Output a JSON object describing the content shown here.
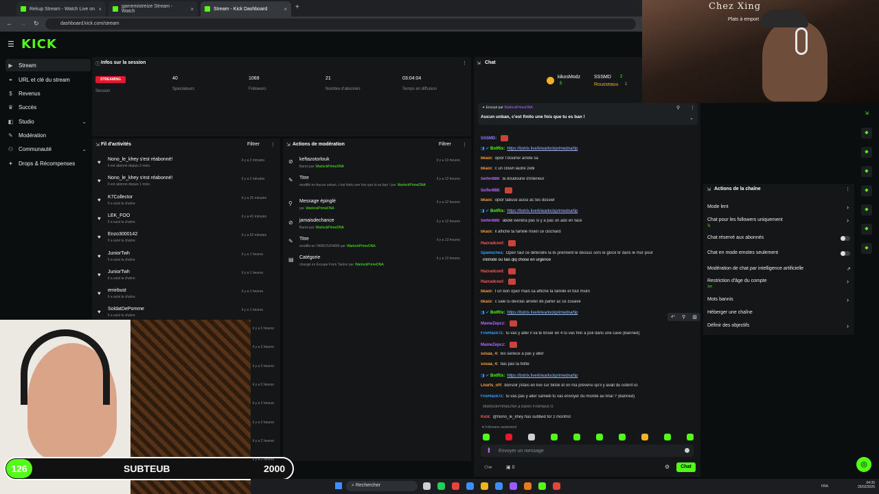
{
  "browser": {
    "tabs": [
      {
        "title": "Rekup Stream - Watch Live on",
        "close": "×"
      },
      {
        "title": "gamemistreize Stream - Watch",
        "close": "×"
      },
      {
        "title": "Stream - Kick Dashboard",
        "close": "×"
      }
    ],
    "new_tab": "+",
    "url": "dashboard.kick.com/stream"
  },
  "header": {
    "logo": "KICK",
    "menu_icon": "hamburger-icon"
  },
  "sidebar": {
    "items": [
      {
        "label": "Stream",
        "icon": "stream-icon"
      },
      {
        "label": "URL et clé du stream",
        "icon": "link-icon"
      },
      {
        "label": "Revenus",
        "icon": "dollar-icon"
      },
      {
        "label": "Succès",
        "icon": "trophy-icon"
      },
      {
        "label": "Studio",
        "icon": "studio-icon"
      },
      {
        "label": "Modération",
        "icon": "wrench-icon"
      },
      {
        "label": "Communauté",
        "icon": "people-icon"
      },
      {
        "label": "Drops & Récompenses",
        "icon": "gift-icon"
      }
    ]
  },
  "session": {
    "title": "Infos sur la session",
    "badge": "STREAMING",
    "stats": [
      {
        "value": "",
        "label": "Session"
      },
      {
        "value": "40",
        "label": "Spectateurs"
      },
      {
        "value": "1069",
        "label": "Followers"
      },
      {
        "value": "21",
        "label": "Nombre d'abonnés"
      },
      {
        "value": "03:04:04",
        "label": "Temps en diffusion"
      }
    ]
  },
  "activity": {
    "title": "Fil d'activités",
    "filter": "Filtrer",
    "items": [
      {
        "name": "Nono_le_khey s'est réabonné!",
        "sub": "Il est abonné depuis 2 mois.",
        "time": "il y a 2 minutes"
      },
      {
        "name": "Nono_le_khey s'est réabonné!",
        "sub": "Il est abonné depuis 1 mois.",
        "time": "il y a 2 minutes"
      },
      {
        "name": "K7Collector",
        "sub": "Il a suivi la chaîne",
        "time": "il y a 25 minutes"
      },
      {
        "name": "LEK_FOO",
        "sub": "Il a suivi la chaîne",
        "time": "il y a 41 minutes"
      },
      {
        "name": "Enzo3000142",
        "sub": "Il a suivi la chaîne",
        "time": "il y a 52 minutes"
      },
      {
        "name": "JuniorTwh",
        "sub": "Il a suivi la chaîne",
        "time": "il y a 1 heures"
      },
      {
        "name": "JuniorTwh",
        "sub": "Il a suivi la chaîne",
        "time": "il y a 1 heures"
      },
      {
        "name": "emirbust",
        "sub": "Il a suivi la chaîne",
        "time": "il y a 1 heures"
      },
      {
        "name": "SoldatDePomme",
        "sub": "Il a suivi la chaîne",
        "time": "il y a 1 heures"
      }
    ],
    "extra_times": [
      "il y a 2 heures",
      "il y a 2 heures",
      "il y a 2 heures",
      "il y a 2 heures",
      "il y a 2 heures",
      "il y a 2 heures",
      "il y a 2 heures",
      "il y a 2 heures"
    ]
  },
  "moderation": {
    "title": "Actions de modération",
    "filter": "Filtrer",
    "items": [
      {
        "title": "keftazotorlouk",
        "sub": "Banni par",
        "by": "WarlockPrimeDNA",
        "time": "il y a 10 heures"
      },
      {
        "title": "Titre",
        "sub": "modifié en Aucun unban, c'est finito une fois que tu es ban ! par",
        "by": "WarlockPrimeDNA",
        "time": "il y a 12 heures"
      },
      {
        "title": "Message épinglé",
        "sub": "par",
        "by": "WarlockPrimeDNA",
        "time": "il y a 12 heures"
      },
      {
        "title": "jamaisdechance",
        "sub": "Banni par",
        "by": "WarlockPrimeDNA",
        "time": "il y a 12 heures"
      },
      {
        "title": "Titre",
        "sub": "modifié en TARKOVFARM par",
        "by": "WarlockPrimeDNA.",
        "time": "il y a 13 heures"
      },
      {
        "title": "Catégorie",
        "sub": "changé en Escape From Tarkov par",
        "by": "WarlockPrimeDNA",
        "time": "il y a 13 heures"
      }
    ]
  },
  "chat": {
    "title": "Chat",
    "top_users": [
      {
        "name": "kikosModz",
        "count": "5"
      },
      {
        "name": "SSSMD",
        "count": "2"
      },
      {
        "name": "Rousseauu",
        "count": "1"
      }
    ],
    "pinned_by_label": "Envoyé par",
    "pinned_by": "WarlockPrimeDNA",
    "pinned_msg": "Aucun unban, c'est finito une fois que tu es ban !",
    "messages": [
      {
        "user": "SSSMD:",
        "text": "",
        "color": "#9b7bff"
      },
      {
        "user": "BotRix:",
        "text": "https://botrix.live/k/warlockprimedna/tip",
        "color": "#53fc18"
      },
      {
        "user": "bkaoi:",
        "text": "opior t bourrer arrete sa",
        "color": "#ff9c3a"
      },
      {
        "user": "bkaoi:",
        "text": "c un clown lautre zebi",
        "color": "#ff9c3a"
      },
      {
        "user": "Seifer888:",
        "text": "la doudoune d'interieur",
        "color": "#b36bff"
      },
      {
        "user": "Seifer888:",
        "text": "",
        "color": "#b36bff"
      },
      {
        "user": "bkaoi:",
        "text": "opior tabuse aussi ac tes dossier",
        "color": "#ff9c3a"
      },
      {
        "user": "BotRix:",
        "text": "https://botrix.live/k/warlockprimedna/tip",
        "color": "#53fc18"
      },
      {
        "user": "Seifer888:",
        "text": "abdel viendra pas si y a pas un ado en face",
        "color": "#b36bff"
      },
      {
        "user": "bkaoi:",
        "text": "il affiche ta famille mskn ce clochard",
        "color": "#ff9c3a"
      },
      {
        "user": "Hazradcool:",
        "text": "",
        "color": "#ff5b5b"
      },
      {
        "user": "Spamiches:",
        "text": "Opior faut ce défendre là ils prennent le dessus sors le glock tir dans le mur pour",
        "color": "#35a0ff"
      },
      {
        "user": "",
        "text": "intimidé ou fais qlq chose en urgence",
        "color": "#ffffff"
      },
      {
        "user": "Hazradcool:",
        "text": "",
        "color": "#ff5b5b"
      },
      {
        "user": "Hazradcool:",
        "text": "",
        "color": "#ff5b5b"
      },
      {
        "user": "bkaoi:",
        "text": "t un bon opior mais sa affiche ta famille et tout mskn",
        "color": "#ff9c3a"
      },
      {
        "user": "bkaoi:",
        "text": "c sale tu devrais arreter de parler ac ce zouave",
        "color": "#ff9c3a"
      },
      {
        "user": "BotRix:",
        "text": "https://botrix.live/k/warlockprimedna/tip",
        "color": "#53fc18"
      },
      {
        "user": "MameZepcz:",
        "text": "",
        "color": "#b36bff"
      },
      {
        "user": "FireHack7z:",
        "text": "tu vas y aller il va te briser en 4 tu vas finir a poil dans une cave (Banned)",
        "color": "#35a0ff"
      },
      {
        "user": "MameZepcz:",
        "text": "",
        "color": "#b36bff"
      },
      {
        "user": "sosaa_4:",
        "text": "tes serieux a pas y aller",
        "color": "#ff9c3a"
      },
      {
        "user": "sosaa_4:",
        "text": "fais pas ta flotte",
        "color": "#ff9c3a"
      },
      {
        "user": "BotRix:",
        "text": "https://botrix.live/k/warlockprimedna/tip",
        "color": "#53fc18"
      },
      {
        "user": "Lharts_off:",
        "text": "bonsoir j'étais en live sur tiktok et on ma prévenu qu'il y avait du cotent ici",
        "color": "#ff9c3a"
      },
      {
        "user": "FireHack7z:",
        "text": "tu vas pas y aller samedi tu vas envoyer du monde au final ? (Banned)",
        "color": "#35a0ff"
      },
      {
        "user": "",
        "text": "WarlockPrimeDNA a banni FireHack7z",
        "color": "#8a8f93"
      },
      {
        "user": "Kick:",
        "text": "@Nono_le_khey has subbed for 2 months!",
        "color": "#ff5b5b"
      }
    ],
    "followers_only": "Followers seulement",
    "input_placeholder": "Envoyer un message",
    "viewers_count": "0",
    "send_label": "Chat"
  },
  "channel_actions": {
    "title": "Actions de la chaîne",
    "items": [
      {
        "label": "Mode lent",
        "sub": "",
        "control": "chevron"
      },
      {
        "label": "Chat pour les followers uniquement",
        "sub": "1j",
        "control": "chevron"
      },
      {
        "label": "Chat réservé aux abonnés",
        "sub": "",
        "control": "toggle"
      },
      {
        "label": "Chat en mode emotes seulement",
        "sub": "",
        "control": "toggle"
      },
      {
        "label": "Modération de chat par intelligence artificielle",
        "sub": "",
        "control": "external"
      },
      {
        "label": "Restriction d'âge du compte",
        "sub": "1m",
        "control": "chevron"
      },
      {
        "label": "Mots bannis",
        "sub": "",
        "control": "chevron"
      },
      {
        "label": "Héberger une chaîne",
        "sub": "",
        "control": "none"
      },
      {
        "label": "Définir des objectifs",
        "sub": "",
        "control": "chevron"
      }
    ]
  },
  "webcam_sign": {
    "line1": "Chez Xing",
    "line2": "Plats à emport"
  },
  "overlay": {
    "left": "126",
    "center": "SUBTEUB",
    "right": "2000"
  },
  "taskbar": {
    "search": "Rechercher",
    "lang": "FRA",
    "time": "04:35",
    "date": "25/02/2026"
  },
  "colors": {
    "accent": "#53fc18",
    "streaming": "#e5182d"
  }
}
